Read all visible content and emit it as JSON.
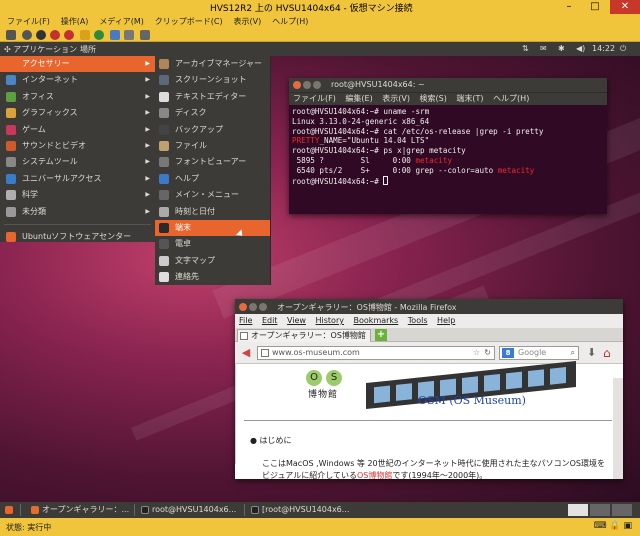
{
  "hyperv": {
    "title": "HVS12R2 上の HVSU1404x64 - 仮想マシン接続",
    "menu": [
      "ファイル(F)",
      "操作(A)",
      "メディア(M)",
      "クリップボード(C)",
      "表示(V)",
      "ヘルプ(H)"
    ],
    "status_label": "状態: 実行中"
  },
  "panel": {
    "applications": "アプリケーション",
    "places": "場所",
    "clock": "14:22"
  },
  "menu_main": [
    {
      "label": "アクセサリー",
      "color": "#e8662e",
      "selected": true
    },
    {
      "label": "インターネット",
      "color": "#4a86c6"
    },
    {
      "label": "オフィス",
      "color": "#5da040"
    },
    {
      "label": "グラフィックス",
      "color": "#d9a23a"
    },
    {
      "label": "ゲーム",
      "color": "#c7385a"
    },
    {
      "label": "サウンドとビデオ",
      "color": "#d05a2a"
    },
    {
      "label": "システムツール",
      "color": "#888888"
    },
    {
      "label": "ユニバーサルアクセス",
      "color": "#3a7ac8"
    },
    {
      "label": "科学",
      "color": "#b0b0b0"
    },
    {
      "label": "未分類",
      "color": "#999999"
    }
  ],
  "menu_main_extra": "Ubuntuソフトウェアセンター",
  "menu_sub": [
    {
      "label": "アーカイブマネージャー",
      "color": "#b0855a"
    },
    {
      "label": "スクリーンショット",
      "color": "#5a6a7a"
    },
    {
      "label": "テキストエディター",
      "color": "#dddddd"
    },
    {
      "label": "ディスク",
      "color": "#888888"
    },
    {
      "label": "バックアップ",
      "color": "#444444"
    },
    {
      "label": "ファイル",
      "color": "#bfa070"
    },
    {
      "label": "フォントビューアー",
      "color": "#777777"
    },
    {
      "label": "ヘルプ",
      "color": "#3a7ac8"
    },
    {
      "label": "メイン・メニュー",
      "color": "#666666"
    },
    {
      "label": "時刻と日付",
      "color": "#aaaaaa"
    },
    {
      "label": "端末",
      "color": "#2b2b2b",
      "selected": true
    },
    {
      "label": "電卓",
      "color": "#555555"
    },
    {
      "label": "文字マップ",
      "color": "#cccccc"
    },
    {
      "label": "連絡先",
      "color": "#dddddd"
    }
  ],
  "terminal": {
    "title": "root@HVSU1404x64: ~",
    "menu": [
      "ファイル(F)",
      "編集(E)",
      "表示(V)",
      "検索(S)",
      "端末(T)",
      "ヘルプ(H)"
    ],
    "lines": [
      {
        "text": "root@HVSU1404x64:~# uname -srm"
      },
      {
        "text": "Linux 3.13.0-24-generic x86_64"
      },
      {
        "text": "root@HVSU1404x64:~# cat /etc/os-release |grep -i pretty"
      },
      {
        "hl": "PRETTY",
        "text": "_NAME=\"Ubuntu 14.04 LTS\""
      },
      {
        "text": "root@HVSU1404x64:~# ps x|grep metacity"
      },
      {
        "text": " 5895 ?        Sl     0:00 ",
        "tail": "metacity"
      },
      {
        "text": " 6540 pts/2    S+     0:00 grep --color=auto ",
        "tail": "metacity"
      },
      {
        "text": "root@HVSU1404x64:~# ",
        "cursor": true
      }
    ]
  },
  "firefox": {
    "title": "オープンギャラリー：OS博物館 - Mozilla Firefox",
    "menu": [
      "File",
      "Edit",
      "View",
      "History",
      "Bookmarks",
      "Tools",
      "Help"
    ],
    "tab_label": "オープンギャラリー：OS博物館",
    "url": "www.os-museum.com",
    "search_placeholder": "Google",
    "logo_letters": [
      "O",
      "S"
    ],
    "logo_text": "博物館",
    "site_title": "OSM (OS Museum)",
    "bullet": "はじめに",
    "body_line1": "ここはMacOS ,Windows 等 20世紀のインターネット時代に使用された主なパソコンOS環境を",
    "body_line2_pre": "ビジュアルに紹介している",
    "body_link": "OS博物館",
    "body_line2_post": "です(1994年～2000年)。"
  },
  "taskbar": [
    {
      "label": "オープンギャラリー：...",
      "color": "#e66b2e"
    },
    {
      "label": "root@HVSU1404x6...",
      "color": "#222222"
    },
    {
      "label": "[root@HVSU1404x6...",
      "color": "#222222"
    }
  ],
  "colors": {
    "accent": "#e8662e",
    "panel": "#3c3b37",
    "terminal_bg": "#300a24",
    "hyperv_chrome": "#f0c53c"
  }
}
